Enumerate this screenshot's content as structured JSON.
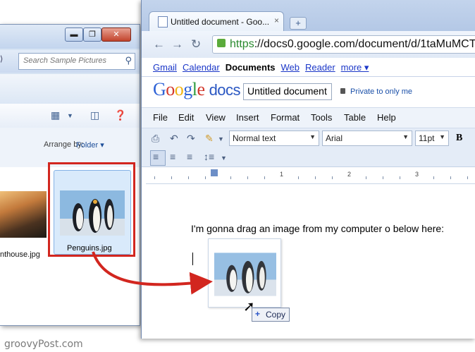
{
  "explorer": {
    "caption_buttons": {
      "minimize": "▬",
      "maximize": "❐",
      "close": "✕"
    },
    "search": {
      "placeholder": "Search Sample Pictures"
    },
    "arrange": {
      "label": "Arrange by:",
      "value": "Folder"
    },
    "files": [
      {
        "name": "nthouse.jpg",
        "selected": false
      },
      {
        "name": "Penguins.jpg",
        "selected": true
      }
    ],
    "icons": [
      "views-icon",
      "preview-pane-icon",
      "help-icon",
      "search-icon"
    ]
  },
  "browser": {
    "tab": {
      "title": "Untitled document - Goo...",
      "close": "×"
    },
    "new_tab": "+",
    "url": {
      "scheme": "https",
      "rest": "://docs0.google.com/document/d/1taMuMCT"
    },
    "google_bar": {
      "links": [
        "Gmail",
        "Calendar",
        "Web",
        "Reader",
        "more ▾"
      ],
      "current": "Documents"
    },
    "logo": {
      "google": "Google",
      "docs": "docs"
    },
    "doc_title": "Untitled document",
    "privacy": "Private to only me",
    "menu": [
      "File",
      "Edit",
      "View",
      "Insert",
      "Format",
      "Tools",
      "Table",
      "Help"
    ],
    "toolbar": {
      "style": "Normal text",
      "font": "Arial",
      "size": "11pt",
      "bold": "B"
    },
    "ruler_numbers": [
      "1",
      "2",
      "3"
    ],
    "body_text": "I'm gonna drag an image from my computer o below here:",
    "drop_badge": "Copy"
  },
  "watermark": "groovyPost.com",
  "colors": {
    "highlight": "#d2261f",
    "link": "#1b37c8",
    "accent_blue": "#2a57c2"
  }
}
